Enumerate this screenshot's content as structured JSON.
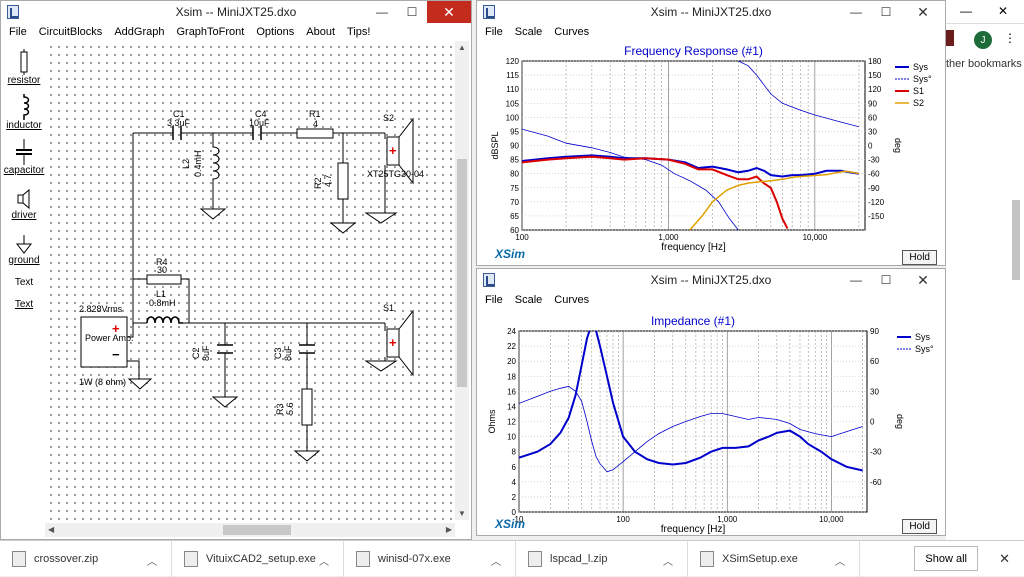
{
  "schematic_window": {
    "title": "Xsim -- MiniJXT25.dxo",
    "menu": [
      "File",
      "CircuitBlocks",
      "AddGraph",
      "GraphToFront",
      "Options",
      "About",
      "Tips!"
    ],
    "tools": [
      "resistor",
      "inductor",
      "capacitor",
      "driver",
      "ground",
      "Text",
      "Text"
    ],
    "labels": {
      "c1": "C1",
      "c1v": "3.3uF",
      "c4": "C4",
      "c4v": "10uF",
      "r1": "R1",
      "r1v": "4",
      "s2": "S2",
      "s2model": "XT25TG30-04",
      "l2": "L2",
      "l2v": "0.4mH",
      "r2": "R2",
      "r2v": "4.7",
      "r4": "R4",
      "r4v": "30",
      "l1": "L1",
      "l1v": "0.8mH",
      "s1": "S1",
      "c2": "C2",
      "c2v": "8uF",
      "c3": "C3",
      "c3v": "8uF",
      "r3": "R3",
      "r3v": "5.6",
      "amp_v": "2.828Vrms",
      "amp_name": "Power Amp.",
      "amp_load": "1W (8 ohm)",
      "plus": "+",
      "minus": "−"
    }
  },
  "fr_window": {
    "title": "Xsim -- MiniJXT25.dxo",
    "menu": [
      "File",
      "Scale",
      "Curves"
    ],
    "brand": "XSim",
    "hold": "Hold"
  },
  "imp_window": {
    "title": "Xsim -- MiniJXT25.dxo",
    "menu": [
      "File",
      "Scale",
      "Curves"
    ],
    "brand": "XSim",
    "hold": "Hold"
  },
  "browser": {
    "avatar": "J",
    "bookmarks": "ther bookmarks"
  },
  "taskbar": {
    "downloads": [
      "crossover.zip",
      "VituixCAD2_setup.exe",
      "winisd-07x.exe",
      "lspcad_l.zip",
      "XSimSetup.exe"
    ],
    "show_all": "Show all"
  },
  "chart_data": [
    {
      "type": "line",
      "title": "Frequency Response (#1)",
      "xlabel": "frequency [Hz]",
      "ylabel": "dBSPL",
      "y2label": "deg",
      "xscale": "log",
      "xlim": [
        100,
        22000
      ],
      "ylim": [
        60,
        120
      ],
      "y2lim": [
        -180,
        180
      ],
      "xticks": [
        100,
        1000,
        10000
      ],
      "xticklabels": [
        "100",
        "1,000",
        "10,000"
      ],
      "yticks": [
        60,
        65,
        70,
        75,
        80,
        85,
        90,
        95,
        100,
        105,
        110,
        115,
        120
      ],
      "y2ticks": [
        -150,
        -120,
        -90,
        -60,
        -30,
        0,
        30,
        60,
        90,
        120,
        150,
        180
      ],
      "y2ticklabels": [
        "-150",
        "-120",
        "-90",
        "-60",
        "-30",
        "0",
        "30",
        "60",
        "90",
        "120",
        "150",
        "180"
      ],
      "grid": true,
      "legend_position": "top-right",
      "series": [
        {
          "name": "Sys",
          "axis": "left",
          "color": "#0000cc",
          "width": 2,
          "x": [
            100,
            150,
            200,
            300,
            400,
            500,
            700,
            1000,
            1300,
            1600,
            2000,
            2500,
            3000,
            3500,
            4000,
            4500,
            5000,
            6000,
            7000,
            8000,
            10000,
            12000,
            15000,
            20000
          ],
          "y": [
            84.5,
            85.5,
            86,
            86.5,
            86,
            85.5,
            85.5,
            85,
            84,
            82,
            82.5,
            81.5,
            80.5,
            81,
            82,
            81,
            79.5,
            79,
            79.5,
            79.5,
            80,
            81,
            81,
            80
          ]
        },
        {
          "name": "Sys°",
          "axis": "right",
          "color": "#0000cc",
          "width": 0.8,
          "x": [
            100,
            150,
            200,
            300,
            400,
            500,
            700,
            900,
            1100,
            1400,
            1800,
            2200,
            2600,
            3000,
            3000.5,
            3500,
            4000,
            5000,
            6000,
            8000,
            10000,
            15000,
            20000
          ],
          "y": [
            35,
            20,
            5,
            -5,
            -15,
            -25,
            -30,
            -42,
            -60,
            -75,
            -95,
            -120,
            -155,
            -180,
            180,
            170,
            150,
            110,
            90,
            75,
            65,
            50,
            40
          ]
        },
        {
          "name": "S1",
          "axis": "left",
          "color": "#dd0000",
          "width": 2,
          "x": [
            100,
            150,
            200,
            300,
            400,
            500,
            700,
            1000,
            1300,
            1600,
            2000,
            2500,
            3000,
            3500,
            4000,
            4500,
            5000,
            5500,
            6000,
            6500
          ],
          "y": [
            84,
            85,
            85.5,
            86,
            85.5,
            85,
            85.5,
            85,
            83.5,
            81.5,
            81.5,
            79.5,
            78,
            78,
            79,
            76.5,
            75,
            70,
            64,
            60.5
          ]
        },
        {
          "name": "S2",
          "axis": "right",
          "color": "#e0a000",
          "width": 1.5,
          "x": [
            1400,
            1700,
            2000,
            2500,
            3000,
            3500,
            4000,
            5000,
            6000,
            7000,
            8000,
            10000,
            12000,
            14000,
            16000,
            18000,
            20000
          ],
          "y": [
            -180,
            -150,
            -120,
            -95,
            -85,
            -80,
            -78,
            -75,
            -72,
            -68,
            -66,
            -64,
            -62,
            -58,
            -55,
            -57,
            -60
          ]
        }
      ]
    },
    {
      "type": "line",
      "title": "Impedance (#1)",
      "xlabel": "frequency [Hz]",
      "ylabel": "Ohms",
      "y2label": "deg",
      "xscale": "log",
      "xlim": [
        10,
        22000
      ],
      "ylim": [
        0,
        24
      ],
      "y2lim": [
        -90,
        90
      ],
      "xticks": [
        10,
        100,
        1000,
        10000
      ],
      "xticklabels": [
        "10",
        "100",
        "1,000",
        "10,000"
      ],
      "yticks": [
        0,
        2,
        4,
        6,
        8,
        10,
        12,
        14,
        16,
        18,
        20,
        22,
        24
      ],
      "y2ticks": [
        -60,
        -30,
        0,
        30,
        60,
        90
      ],
      "y2ticklabels": [
        "-60",
        "-30",
        "0",
        "30",
        "60",
        "90"
      ],
      "grid": true,
      "legend_position": "top-right",
      "series": [
        {
          "name": "Sys",
          "axis": "left",
          "color": "#0000cc",
          "width": 2,
          "x": [
            10,
            15,
            20,
            25,
            30,
            35,
            40,
            45,
            50,
            55,
            60,
            70,
            80,
            100,
            130,
            170,
            220,
            300,
            400,
            550,
            700,
            900,
            1200,
            1600,
            2000,
            2500,
            3000,
            4000,
            5000,
            6000,
            8000,
            10000,
            14000,
            20000
          ],
          "y": [
            7.2,
            8,
            9,
            10.5,
            12.5,
            15.5,
            19.5,
            23,
            25,
            24,
            22,
            18,
            14.5,
            10,
            8,
            7,
            6.5,
            6.3,
            6.5,
            7.2,
            8,
            8.5,
            8.5,
            8.7,
            9.5,
            10,
            10.5,
            10.8,
            10,
            9,
            8,
            7,
            6,
            5.5
          ]
        },
        {
          "name": "Sys°",
          "axis": "right",
          "color": "#0000cc",
          "width": 0.8,
          "x": [
            10,
            15,
            20,
            25,
            30,
            35,
            40,
            45,
            50,
            55,
            60,
            70,
            80,
            100,
            130,
            170,
            220,
            300,
            400,
            550,
            700,
            900,
            1200,
            1600,
            2000,
            2500,
            3000,
            4000,
            5000,
            7000,
            10000,
            14000,
            20000
          ],
          "y": [
            18,
            25,
            30,
            33,
            35,
            30,
            20,
            0,
            -20,
            -35,
            -42,
            -50,
            -48,
            -40,
            -30,
            -20,
            -12,
            -5,
            0,
            5,
            8,
            8,
            5,
            2,
            4,
            3,
            2,
            -2,
            -8,
            -12,
            -15,
            -10,
            -5
          ]
        }
      ]
    }
  ]
}
